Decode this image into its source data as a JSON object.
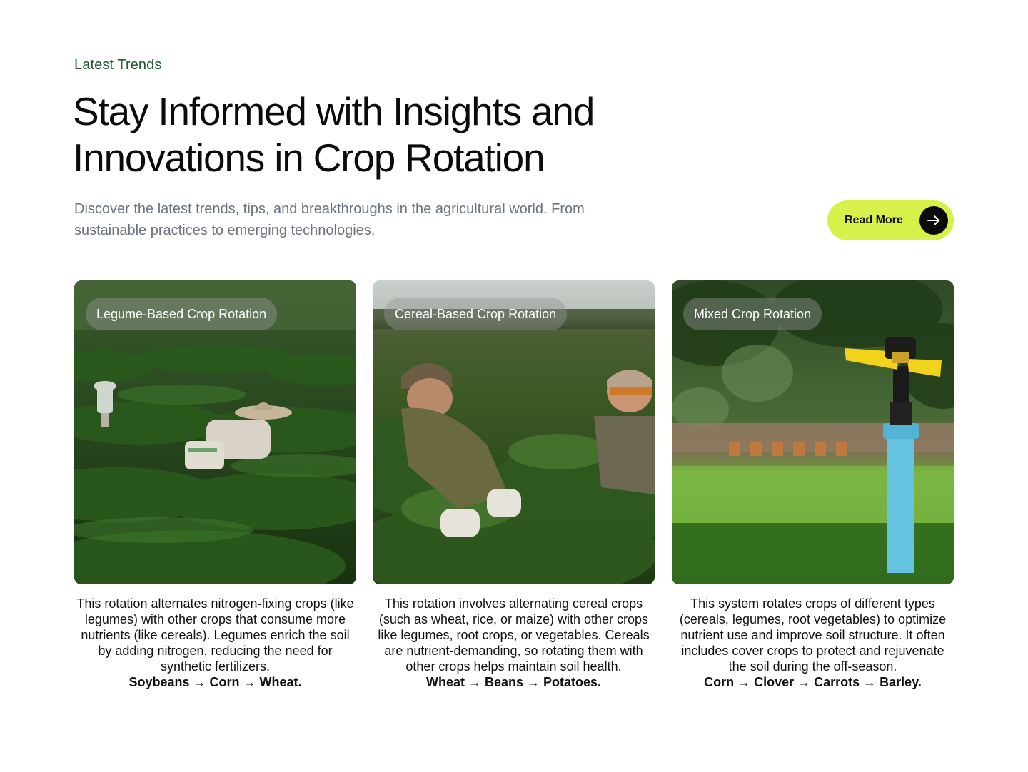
{
  "header": {
    "eyebrow": "Latest Trends",
    "title_line1": "Stay Informed with Insights and",
    "title_line2": "Innovations in Crop Rotation",
    "intro": "Discover the latest trends, tips, and breakthroughs in the agricultural world. From sustainable practices to emerging technologies,",
    "button_label": "Read More",
    "button_icon": "arrow-right-icon"
  },
  "colors": {
    "accent": "#d8f04a",
    "eyebrow": "#1e5a32",
    "muted_text": "#6b7280",
    "dark": "#0b0b0b"
  },
  "cards": [
    {
      "tag": "Legume-Based Crop Rotation",
      "photo": "tea-field-workers-photo",
      "description": "This rotation alternates nitrogen-fixing crops (like legumes) with other crops that consume more nutrients (like cereals). Legumes enrich the soil by adding nitrogen, reducing the need for synthetic fertilizers.",
      "sequence": "Soybeans → Corn → Wheat."
    },
    {
      "tag": "Cereal-Based Crop Rotation",
      "photo": "farmers-harvesting-photo",
      "description": "This rotation involves alternating cereal crops (such as wheat, rice, or maize) with other crops like legumes, root crops, or vegetables. Cereals are nutrient-demanding, so rotating them with other crops helps maintain soil health.",
      "sequence": "Wheat → Beans → Potatoes."
    },
    {
      "tag": "Mixed Crop Rotation",
      "photo": "irrigation-sprinkler-photo",
      "description": "This system rotates crops of different types (cereals, legumes, root vegetables) to optimize nutrient use and improve soil structure. It often includes cover crops to protect and rejuvenate the soil during the off-season.",
      "sequence": "Corn → Clover → Carrots → Barley."
    }
  ]
}
